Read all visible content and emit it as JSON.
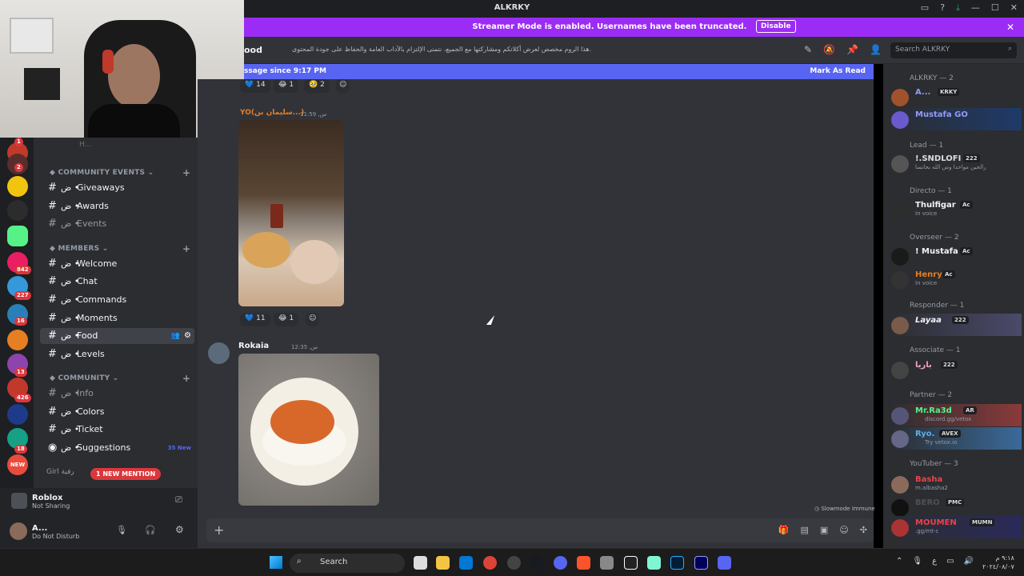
{
  "window": {
    "title": "ALKRKY"
  },
  "streamer_bar": {
    "text": "Streamer Mode is enabled. Usernames have been truncated.",
    "disable_label": "Disable"
  },
  "channel_header": {
    "name": "ood",
    "topic": "هذا الروم مخصص لعرض أكلاتكم ومشاركتها مع الجميع، نتمنى الإلتزام بالآداب العامة والحفاظ على جودة المحتوى.",
    "search_placeholder": "Search ALKRKY"
  },
  "unread_bar": {
    "text": "ssage since 9:17 PM",
    "mark_label": "Mark As Read"
  },
  "guild_badges": [
    "1",
    "2",
    "842",
    "227",
    "16",
    "13",
    "426",
    "18"
  ],
  "guild_new": "NEW",
  "sidebar": {
    "top_hint": "H...",
    "categories": [
      {
        "name": "COMMUNITY EVENTS"
      },
      {
        "name": "MEMBERS"
      },
      {
        "name": "COMMUNITY"
      }
    ],
    "channels": {
      "giveaways": "Giveaways",
      "awards": "Awards",
      "events": "Events",
      "welcome": "Welcome",
      "chat": "Chat",
      "commands": "Commands",
      "moments": "Moments",
      "food": "Food",
      "levels": "Levels",
      "info": "Info",
      "colors": "Colors",
      "ticket": "Ticket",
      "suggestions": "Suggestions",
      "girl": "Girl رفية"
    },
    "channel_prefix": "ض •",
    "suggestions_new": "35 New",
    "mention_pill": "1 NEW MENTION"
  },
  "activity": {
    "title": "Roblox",
    "subtitle": "Not Sharing"
  },
  "user": {
    "name": "A...",
    "status": "Do Not Disturb"
  },
  "messages": [
    {
      "reactions": [
        {
          "emoji": "💙",
          "count": "14"
        },
        {
          "emoji": "😂",
          "count": "1"
        },
        {
          "emoji": "🥹",
          "count": "2"
        }
      ]
    },
    {
      "author": "YO(سليمان بن...)",
      "time": "11:59 ,س",
      "reactions": [
        {
          "emoji": "💙",
          "count": "11"
        },
        {
          "emoji": "😂",
          "count": "1"
        }
      ]
    },
    {
      "author": "Rokaia",
      "time": "12:35 ,س"
    }
  ],
  "composer": {
    "placeholder": ""
  },
  "slowmode": "Slowmode Immune",
  "members": {
    "groups": [
      {
        "title": "ALKRKY — 2"
      },
      {
        "title": "Lead — 1"
      },
      {
        "title": "Directo — 1"
      },
      {
        "title": "Overseer — 2"
      },
      {
        "title": "Responder — 1"
      },
      {
        "title": "Associate — 1"
      },
      {
        "title": "Partner — 2"
      },
      {
        "title": "YouTuber — 3"
      }
    ],
    "list": [
      {
        "name": "A...",
        "tag": "KRKY",
        "sub": "",
        "color": "#949cf7"
      },
      {
        "name": "Mustafa GO",
        "tag": "",
        "sub": "",
        "color": "#949cf7"
      },
      {
        "name": "!.SNDLOFI",
        "tag": "222",
        "sub": "رالحين مواحدا وس الله بحانسا",
        "color": "#dbdee1"
      },
      {
        "name": "Thulfigar",
        "tag": "Ac",
        "sub": "In voice",
        "color": "#f2f3f5"
      },
      {
        "name": "! Mustafa",
        "tag": "Ac",
        "sub": "",
        "color": "#f2f3f5"
      },
      {
        "name": "Henry",
        "tag": "Ac",
        "sub": "In voice",
        "color": "#e67e22"
      },
      {
        "name": "Layaa",
        "tag": "222",
        "sub": "",
        "color": "#f2f3f5"
      },
      {
        "name": "باريا",
        "tag": "222",
        "sub": "",
        "color": "#f5a3c7"
      },
      {
        "name": "Mr.Ra3d",
        "tag": "AR",
        "sub": "discord.gg/vetox",
        "color": "#57f287"
      },
      {
        "name": "Ryo.",
        "tag": "AVEX",
        "sub": "Try vetox.io",
        "color": "#5dadec"
      },
      {
        "name": "Basha",
        "tag": "",
        "sub": "m.albasha2",
        "color": "#ed4245"
      },
      {
        "name": "BERO",
        "tag": "PMC",
        "sub": "",
        "color": "#4e5058"
      },
      {
        "name": "MOUMEN",
        "tag": "MUMN",
        "sub": ".gg/mt-c",
        "color": "#ed4245"
      }
    ]
  },
  "taskbar": {
    "search_label": "Search",
    "clock_time": "٩:١٨ م",
    "clock_date": "٢٠٢٤/٠٨/٠٧",
    "lang": "ع"
  }
}
